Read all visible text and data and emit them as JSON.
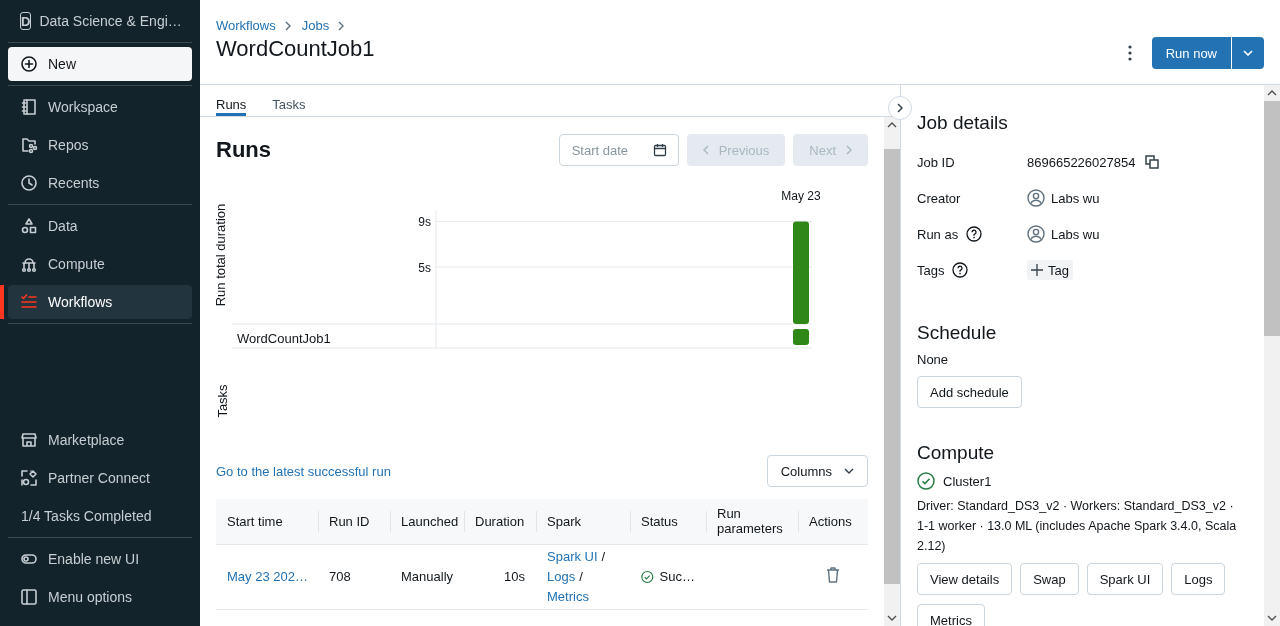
{
  "sidebar": {
    "workspace": {
      "letter": "D",
      "name": "Data Science & Engi…"
    },
    "top_sections": [
      [
        {
          "kind": "button",
          "label": "New",
          "selected": false
        }
      ],
      [
        {
          "kind": "nav",
          "label": "Workspace",
          "selected": false
        },
        {
          "kind": "nav",
          "label": "Repos",
          "selected": false
        },
        {
          "kind": "nav",
          "label": "Recents",
          "selected": false
        }
      ],
      [
        {
          "kind": "nav",
          "label": "Data",
          "selected": false
        },
        {
          "kind": "nav",
          "label": "Compute",
          "selected": false
        },
        {
          "kind": "nav",
          "label": "Workflows",
          "selected": true
        }
      ]
    ],
    "bottom_sections": [
      [
        {
          "kind": "nav",
          "label": "Marketplace",
          "selected": false
        },
        {
          "kind": "nav",
          "label": "Partner Connect",
          "selected": false
        },
        {
          "kind": "text",
          "label": "1/4 Tasks Completed",
          "selected": false
        }
      ],
      [
        {
          "kind": "nav",
          "label": "Enable new UI",
          "selected": false
        },
        {
          "kind": "nav",
          "label": "Menu options",
          "selected": false
        }
      ]
    ]
  },
  "header": {
    "breadcrumbs": [
      "Workflows",
      "Jobs"
    ],
    "title": "WordCountJob1",
    "run_button": "Run now"
  },
  "tabs": [
    {
      "label": "Runs",
      "selected": true
    },
    {
      "label": "Tasks",
      "selected": false
    }
  ],
  "runs": {
    "heading": "Runs",
    "start_date": {
      "placeholder": "Start date"
    },
    "previous": {
      "label": "Previous",
      "disabled": true
    },
    "next": {
      "label": "Next",
      "disabled": true
    },
    "chart": {
      "duration_label": "Run total duration",
      "chart_data": {
        "type": "bar",
        "categories": [
          "May 23"
        ],
        "series": [
          {
            "color": "#2e8716",
            "values": [
              9
            ]
          }
        ],
        "ylim": [
          0,
          10
        ],
        "yticks": [
          {
            "value": 5,
            "label": "5s"
          },
          {
            "value": 9,
            "label": "9s"
          }
        ]
      },
      "tasks_label": "Tasks",
      "task_rows": [
        {
          "name": "WordCountJob1",
          "color": "#2e8716"
        }
      ]
    },
    "latest_link": "Go to the latest successful run",
    "columns_button": "Columns",
    "table": {
      "columns": [
        "Start time",
        "Run ID",
        "Launched",
        "Duration",
        "Spark",
        "Status",
        "Run parameters",
        "Actions"
      ],
      "rows": [
        {
          "start_time": "May 23 202…",
          "run_id": "708",
          "launched": "Manually",
          "duration": "10s",
          "spark": [
            {
              "label": "Spark UI",
              "separator": "/"
            },
            {
              "label": "Logs",
              "separator": "/"
            },
            {
              "label": "Metrics"
            }
          ],
          "status": {
            "kind": "success",
            "label": "Suc…"
          }
        }
      ]
    }
  },
  "details": {
    "heading": "Job details",
    "fields": [
      {
        "kind": "id",
        "label": "Job ID",
        "help": false,
        "value": "869665226027854"
      },
      {
        "kind": "user",
        "label": "Creator",
        "help": false,
        "value": "Labs wu"
      },
      {
        "kind": "user",
        "label": "Run as",
        "help": true,
        "value": "Labs wu"
      },
      {
        "kind": "tag",
        "label": "Tags",
        "help": true,
        "value": "Tag"
      }
    ],
    "schedule": {
      "heading": "Schedule",
      "value": "None",
      "button": "Add schedule"
    },
    "compute": {
      "heading": "Compute",
      "cluster": {
        "name": "Cluster1",
        "running": true
      },
      "description": "Driver: Standard_DS3_v2 · Workers: Standard_DS3_v2 · 1-1 worker · 13.0 ML (includes Apache Spark 3.4.0, Scala 2.12)",
      "buttons": [
        "View details",
        "Swap",
        "Spark UI",
        "Logs",
        "Metrics"
      ]
    }
  }
}
